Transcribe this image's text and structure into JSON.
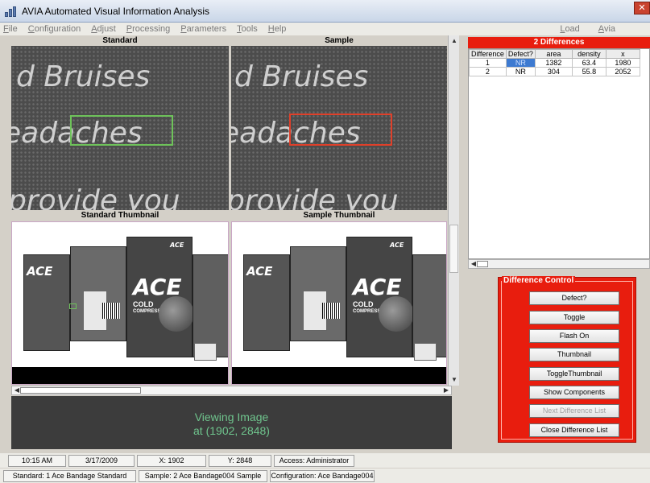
{
  "window": {
    "title": "AVIA Automated Visual Information Analysis",
    "close_glyph": "✕"
  },
  "menu": {
    "left": [
      "File",
      "Configuration",
      "Adjust",
      "Processing",
      "Parameters",
      "Tools",
      "Help"
    ],
    "right": [
      "Load",
      "Avia"
    ]
  },
  "panels": {
    "standard_label": "Standard",
    "sample_label": "Sample",
    "standard_thumb_label": "Standard Thumbnail",
    "sample_thumb_label": "Sample Thumbnail",
    "zoom_lines": [
      "d Bruises",
      "eadaches",
      "provide you"
    ]
  },
  "thumbnail": {
    "logo": "ACE",
    "small_logo": "ACE",
    "cold_text": "COLD",
    "compress_text": "COMPRESS"
  },
  "viewing": {
    "line1": "Viewing Image",
    "line2": "at (1902, 2848)"
  },
  "differences": {
    "header": "2 Differences",
    "columns": [
      "Difference",
      "Defect?",
      "area",
      "density",
      "x"
    ],
    "rows": [
      [
        "1",
        "NR",
        "1382",
        "63.4",
        "1980"
      ],
      [
        "2",
        "NR",
        "304",
        "55.8",
        "2052"
      ]
    ]
  },
  "control": {
    "legend": "Difference Control",
    "buttons": [
      {
        "label": "Defect?",
        "enabled": true
      },
      {
        "label": "Toggle",
        "enabled": true
      },
      {
        "label": "Flash On",
        "enabled": true
      },
      {
        "label": "Thumbnail",
        "enabled": true
      },
      {
        "label": "ToggleThumbnail",
        "enabled": true
      },
      {
        "label": "Show Components",
        "enabled": true
      },
      {
        "label": "Next Difference List",
        "enabled": false
      },
      {
        "label": "Close Difference List",
        "enabled": true
      }
    ]
  },
  "status": {
    "time": "10:15 AM",
    "date": "3/17/2009",
    "x": "X: 1902",
    "y": "Y: 2848",
    "access": "Access: Administrator",
    "standard": "Standard: 1 Ace Bandage Standard",
    "sample": "Sample: 2 Ace Bandage004 Sample",
    "configuration": "Configuration: Ace Bandage004"
  },
  "colors": {
    "accent_red": "#e81d0e",
    "standard_box": "#6ec25a",
    "sample_box": "#e0402a",
    "viewing_text": "#6fc48d"
  }
}
